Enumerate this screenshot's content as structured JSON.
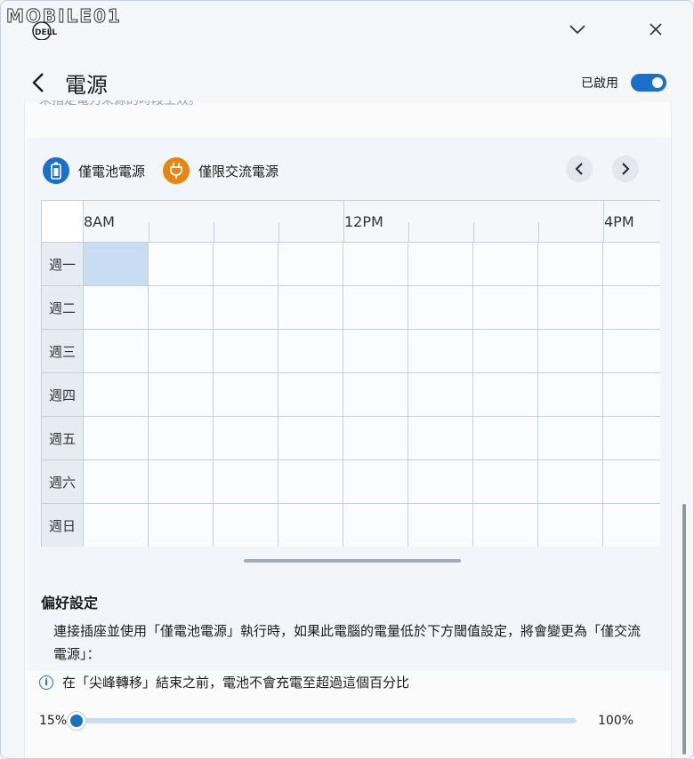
{
  "watermark": {
    "text": "MOBILE01",
    "badge": "DELL"
  },
  "titlebar": {
    "minimize_glyph": "⌄",
    "close_glyph": "✕"
  },
  "header": {
    "title": "電源",
    "enabled_label": "已啟用",
    "enabled": true
  },
  "clipped_text": "未指定電力來源的時段生效。",
  "legend": {
    "battery_label": "僅電池電源",
    "ac_label": "僅限交流電源",
    "battery_color": "#1a6fc9",
    "ac_color": "#e8860f",
    "battery_icon": "battery-icon",
    "ac_icon": "plug-icon"
  },
  "schedule": {
    "hour_labels": [
      "8AM",
      "12PM",
      "4PM"
    ],
    "days": [
      "週一",
      "週二",
      "週三",
      "週四",
      "週五",
      "週六",
      "週日"
    ],
    "selected_cell": {
      "day": "週一",
      "hour": "8AM"
    }
  },
  "preferences": {
    "title": "偏好設定",
    "description": "連接插座並使用「僅電池電源」執行時，如果此電腦的電量低於下方閾值設定，將會變更為「僅交流電源」：",
    "info_text": "在「尖峰轉移」結束之前，電池不會充電至超過這個百分比",
    "slider_min": "15%",
    "slider_max": "100%",
    "slider_value_fraction": 0
  }
}
